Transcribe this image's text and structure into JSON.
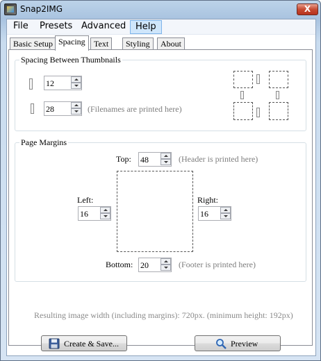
{
  "window": {
    "title": "Snap2IMG",
    "close_glyph": "X"
  },
  "menu": [
    "File",
    "Presets",
    "Advanced",
    "Help"
  ],
  "tabs": [
    "Basic Setup",
    "Spacing",
    "Text",
    "Styling",
    "About"
  ],
  "spacing": {
    "group_label": "Spacing Between Thumbnails",
    "horizontal_value": "12",
    "vertical_value": "28",
    "vertical_hint": "(Filenames are printed here)"
  },
  "margins": {
    "group_label": "Page Margins",
    "top_label": "Top:",
    "top_value": "48",
    "top_hint": "(Header is printed here)",
    "left_label": "Left:",
    "left_value": "16",
    "right_label": "Right:",
    "right_value": "16",
    "bottom_label": "Bottom:",
    "bottom_value": "20",
    "bottom_hint": "(Footer is printed here)"
  },
  "status_text": "Resulting image width (including margins): 720px. (minimum height: 192px)",
  "buttons": {
    "create_save": "Create & Save...",
    "preview": "Preview"
  },
  "icons": {
    "create_save": "floppy-disk-icon",
    "preview": "magnifier-icon"
  },
  "colors": {
    "titlebar": "#a9c3e0",
    "close_button": "#c74a32",
    "active_menu": "#cfe6fb"
  }
}
